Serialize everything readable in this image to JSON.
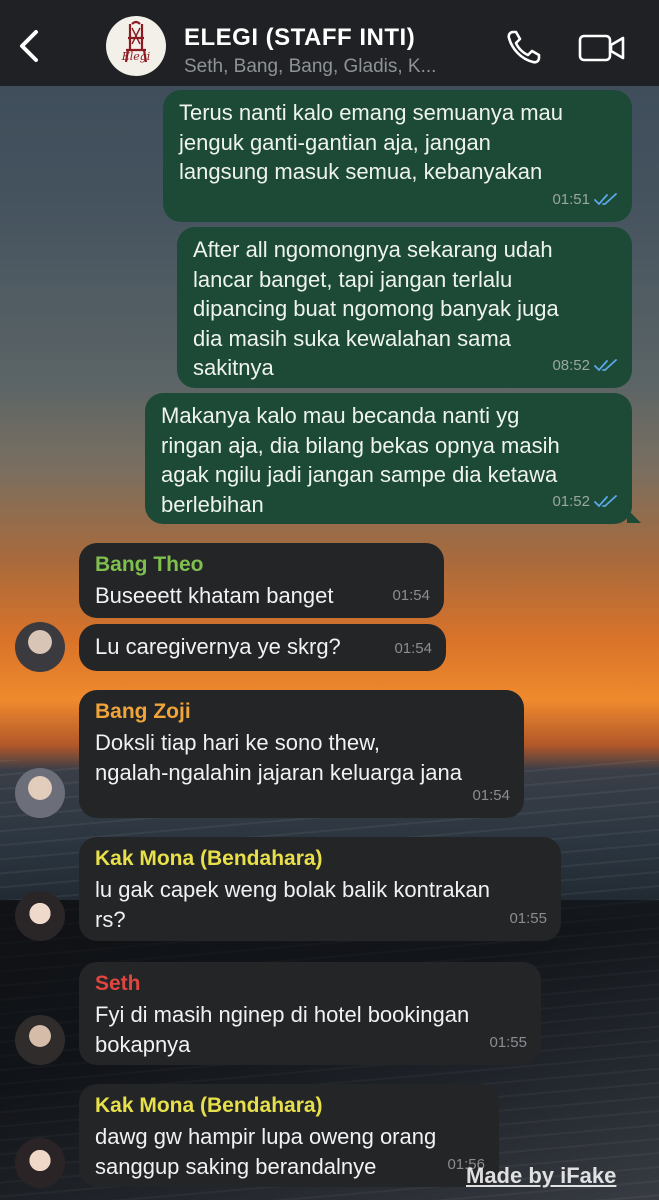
{
  "header": {
    "back_icon": "chevron-left-icon",
    "group_title": "ELEGI (STAFF INTI)",
    "group_members": "Seth, Bang, Bang, Gladis, K...",
    "group_logo_text": "Elegi",
    "call_icon": "phone-icon",
    "video_icon": "video-camera-icon"
  },
  "messages": [
    {
      "direction": "out",
      "text": "Terus nanti kalo emang semuanya mau\njenguk ganti-gantian aja, jangan\nlangsung masuk semua, kebanyakan",
      "time": "01:51",
      "status": "read"
    },
    {
      "direction": "out",
      "text": "After all ngomongnya sekarang udah\nlancar banget, tapi jangan terlalu\ndipancing buat ngomong banyak juga\ndia masih suka kewalahan sama\nsakitnya",
      "time": "08:52",
      "status": "read"
    },
    {
      "direction": "out",
      "text": "Makanya kalo mau becanda nanti yg\nringan aja, dia bilang bekas opnya masih\nagak ngilu jadi jangan sampe dia ketawa\nberlebihan",
      "time": "01:52",
      "status": "read"
    },
    {
      "direction": "in",
      "sender": "Bang Theo",
      "sender_color": "#7fbf4d",
      "text": "Buseeett khatam banget",
      "time": "01:54"
    },
    {
      "direction": "in",
      "text": "Lu caregivernya ye skrg?",
      "time": "01:54"
    },
    {
      "direction": "in",
      "sender": "Bang Zoji",
      "sender_color": "#f0a43a",
      "text": "Doksli tiap hari ke sono thew,\nngalah-ngalahin jajaran keluarga jana",
      "time": "01:54"
    },
    {
      "direction": "in",
      "sender": "Kak Mona (Bendahara)",
      "sender_color": "#e8e04a",
      "text": "lu gak capek weng bolak balik kontrakan\nrs?",
      "time": "01:55"
    },
    {
      "direction": "in",
      "sender": "Seth",
      "sender_color": "#e0463f",
      "text": "Fyi di masih nginep di hotel bookingan\nbokapnya",
      "time": "01:55"
    },
    {
      "direction": "in",
      "sender": "Kak Mona (Bendahara)",
      "sender_color": "#e8e04a",
      "text": "dawg gw hampir lupa oweng orang\nsanggup saking berandalnye",
      "time": "01:56"
    }
  ],
  "watermark": "Made by iFake",
  "colors": {
    "header_bg": "#1f2124",
    "outgoing_bubble": "#1d4a36",
    "incoming_bubble": "#232527",
    "read_ticks": "#5aa8e8"
  }
}
